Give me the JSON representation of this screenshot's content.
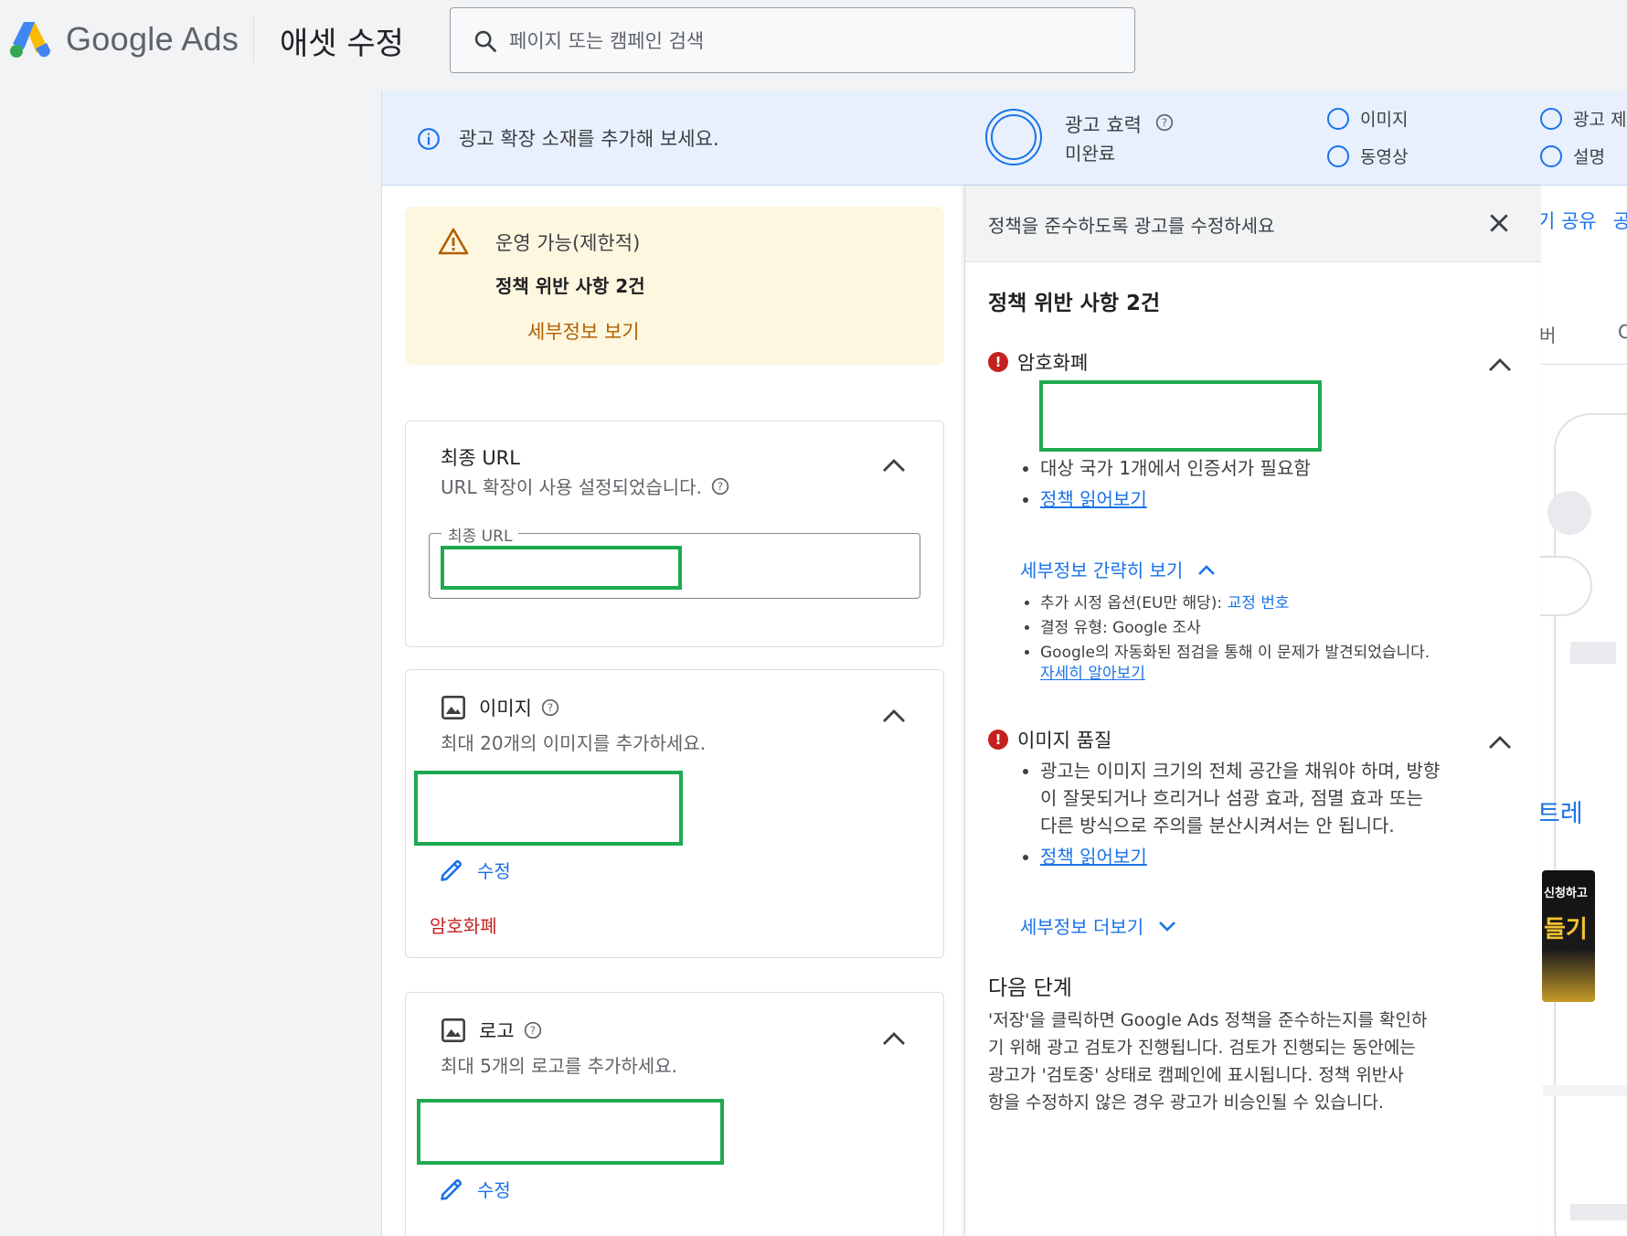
{
  "header": {
    "brand": "Google Ads",
    "page_title": "애셋 수정",
    "search_placeholder": "페이지 또는 캠페인 검색"
  },
  "banner": {
    "info_text": "광고 확장 소재를 추가해 보세요.",
    "strength_label": "광고 효력",
    "strength_value": "미완료",
    "checklist": [
      "이미지",
      "동영상",
      "광고 제",
      "설명"
    ]
  },
  "status_card": {
    "status": "운영 가능(제한적)",
    "violations": "정책 위반 사항 2건",
    "details_link": "세부정보 보기"
  },
  "final_url_card": {
    "title": "최종 URL",
    "subtitle": "URL 확장이 사용 설정되었습니다.",
    "field_label": "최종 URL"
  },
  "images_card": {
    "title": "이미지",
    "subtitle": "최대 20개의 이미지를 추가하세요.",
    "edit_label": "수정",
    "violation_label": "암호화폐"
  },
  "logo_card": {
    "title": "로고",
    "subtitle": "최대 5개의 로고를 추가하세요.",
    "edit_label": "수정"
  },
  "policy_panel": {
    "title": "정책을 준수하도록 광고를 수정하세요",
    "count": "정책 위반 사항 2건",
    "issue1": {
      "title": "암호화폐",
      "bullet1": "대상 국가 1개에서 인증서가 필요함",
      "bullet2_link": "정책 읽어보기",
      "toggle": "세부정보 간략히 보기",
      "detail1_prefix": "추가 시정 옵션(EU만 해당): ",
      "detail1_link": "교정 번호",
      "detail2": "결정 유형: Google 조사",
      "detail3": "Google의 자동화된 점검을 통해 이 문제가 발견되었습니다.",
      "detail3_link": "자세히 알아보기"
    },
    "issue2": {
      "title": "이미지 품질",
      "bullet1_line1": "광고는 이미지 크기의 전체 공간을 채워야 하며, 방향",
      "bullet1_line2": "이 잘못되거나 흐리거나 섬광 효과, 점멸 효과 또는",
      "bullet1_line3": "다른 방식으로 주의를 분산시켜서는 안 됩니다.",
      "bullet2_link": "정책 읽어보기",
      "toggle": "세부정보 더보기"
    },
    "next_steps_title": "다음 단계",
    "next_steps_line1": "'저장'을 클릭하면 Google Ads 정책을 준수하는지를 확인하",
    "next_steps_line2": "기 위해 광고 검토가 진행됩니다. 검토가 진행되는 동안에는",
    "next_steps_line3": "광고가 '검토중' 상태로 캠페인에 표시됩니다. 정책 위반사",
    "next_steps_line4": "항을 수정하지 않은 경우 광고가 비승인될 수 있습니다."
  },
  "background": {
    "share_text": "기 공유",
    "share_text2": "공",
    "tab_text": "버",
    "tab_text2": "C",
    "word": "트레",
    "thumb_text1": "신청하고",
    "thumb_text2": "들기"
  },
  "colors": {
    "accent": "#1a73e8",
    "warning_bg": "#fef7e0",
    "warning_link": "#b06000",
    "error": "#c5221f",
    "redaction_box": "#1fa94f"
  },
  "icons": [
    "google-ads-logo",
    "search-icon",
    "info-icon",
    "help-icon",
    "warning-icon",
    "chevron-up-icon",
    "chevron-down-icon",
    "image-icon",
    "edit-pencil-icon",
    "close-icon",
    "error-icon"
  ]
}
